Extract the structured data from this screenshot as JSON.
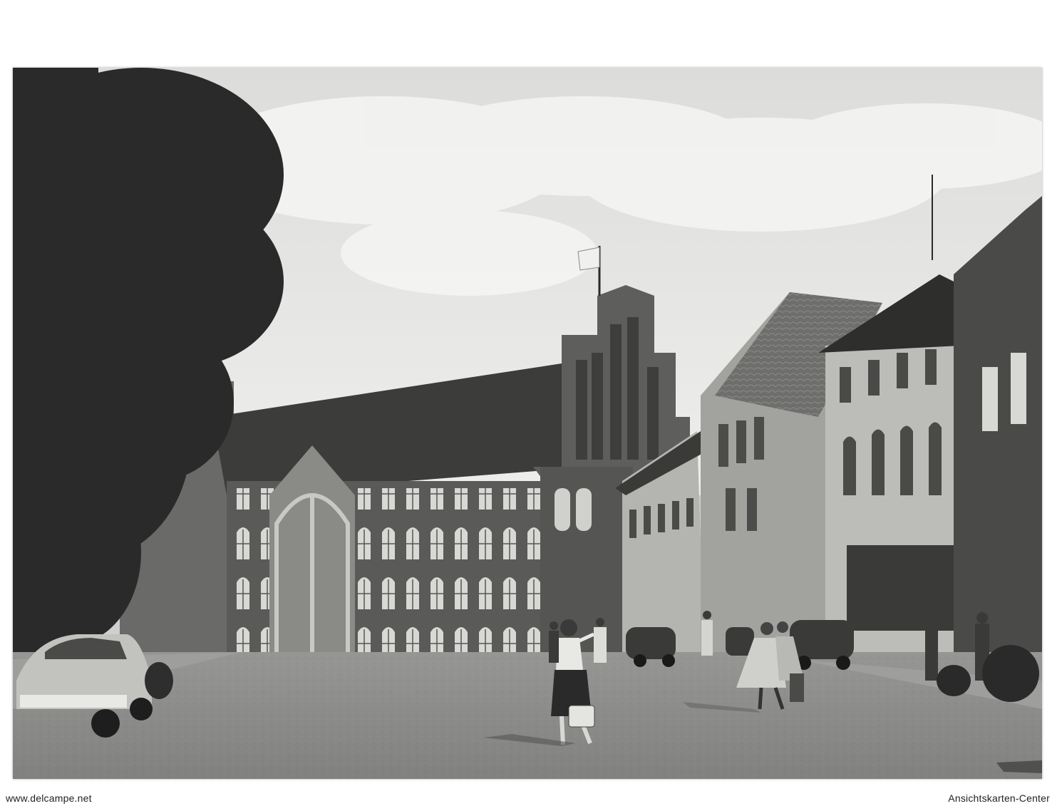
{
  "footer": {
    "left_watermark": "www.delcampe.net",
    "right_watermark": "Ansichtskarten-Center"
  },
  "photo": {
    "style": "black-and-white vintage postcard photograph",
    "tones": {
      "sky": "#e6e6e4",
      "cloud": "#f4f4f2",
      "tree": "#2a2a2a",
      "roof": "#3c3c3c",
      "brick": "#5a5a58",
      "facade_light": "#a8a8a4",
      "pavement": "#8c8c8a"
    }
  }
}
